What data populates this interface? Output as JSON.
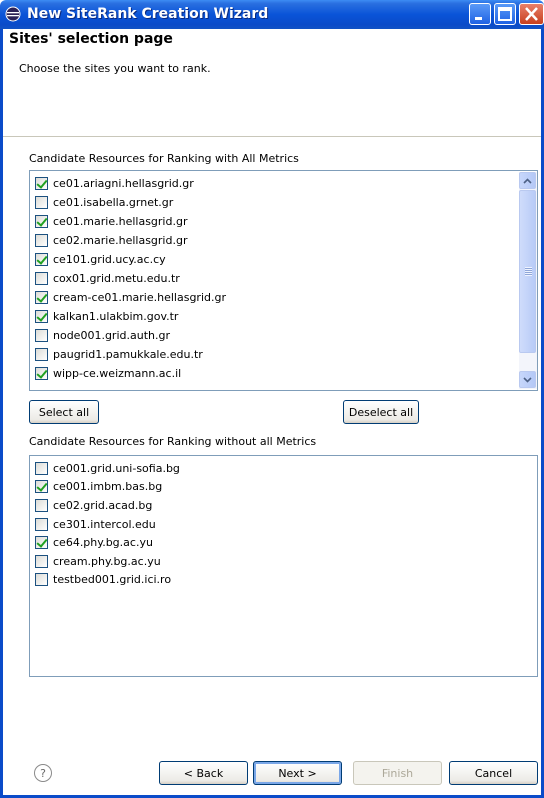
{
  "window": {
    "title": "New SiteRank Creation Wizard",
    "icon": "eclipse-app-icon"
  },
  "header": {
    "title": "Sites' selection page",
    "description": "Choose the sites you want to rank."
  },
  "all_metrics": {
    "label": "Candidate Resources for Ranking with All Metrics",
    "items": [
      {
        "label": "ce01.ariagni.hellasgrid.gr",
        "checked": true
      },
      {
        "label": "ce01.isabella.grnet.gr",
        "checked": false
      },
      {
        "label": "ce01.marie.hellasgrid.gr",
        "checked": true
      },
      {
        "label": "ce02.marie.hellasgrid.gr",
        "checked": false
      },
      {
        "label": "ce101.grid.ucy.ac.cy",
        "checked": true
      },
      {
        "label": "cox01.grid.metu.edu.tr",
        "checked": false
      },
      {
        "label": "cream-ce01.marie.hellasgrid.gr",
        "checked": true
      },
      {
        "label": "kalkan1.ulakbim.gov.tr",
        "checked": true
      },
      {
        "label": "node001.grid.auth.gr",
        "checked": false
      },
      {
        "label": "paugrid1.pamukkale.edu.tr",
        "checked": false
      },
      {
        "label": "wipp-ce.weizmann.ac.il",
        "checked": true
      }
    ]
  },
  "buttons": {
    "select_all": "Select all",
    "deselect_all": "Deselect all",
    "back": "< Back",
    "next": "Next >",
    "finish": "Finish",
    "cancel": "Cancel",
    "help": "?"
  },
  "partial_metrics": {
    "label": "Candidate Resources for Ranking without all  Metrics",
    "items": [
      {
        "label": "ce001.grid.uni-sofia.bg",
        "checked": false
      },
      {
        "label": "ce001.imbm.bas.bg",
        "checked": true
      },
      {
        "label": "ce02.grid.acad.bg",
        "checked": false
      },
      {
        "label": "ce301.intercol.edu",
        "checked": false
      },
      {
        "label": "ce64.phy.bg.ac.yu",
        "checked": true
      },
      {
        "label": "cream.phy.bg.ac.yu",
        "checked": false
      },
      {
        "label": "testbed001.grid.ici.ro",
        "checked": false
      }
    ]
  },
  "colors": {
    "titlebar": "#0a54d8",
    "checkmark": "#21a121",
    "list_border": "#7f9db9"
  }
}
